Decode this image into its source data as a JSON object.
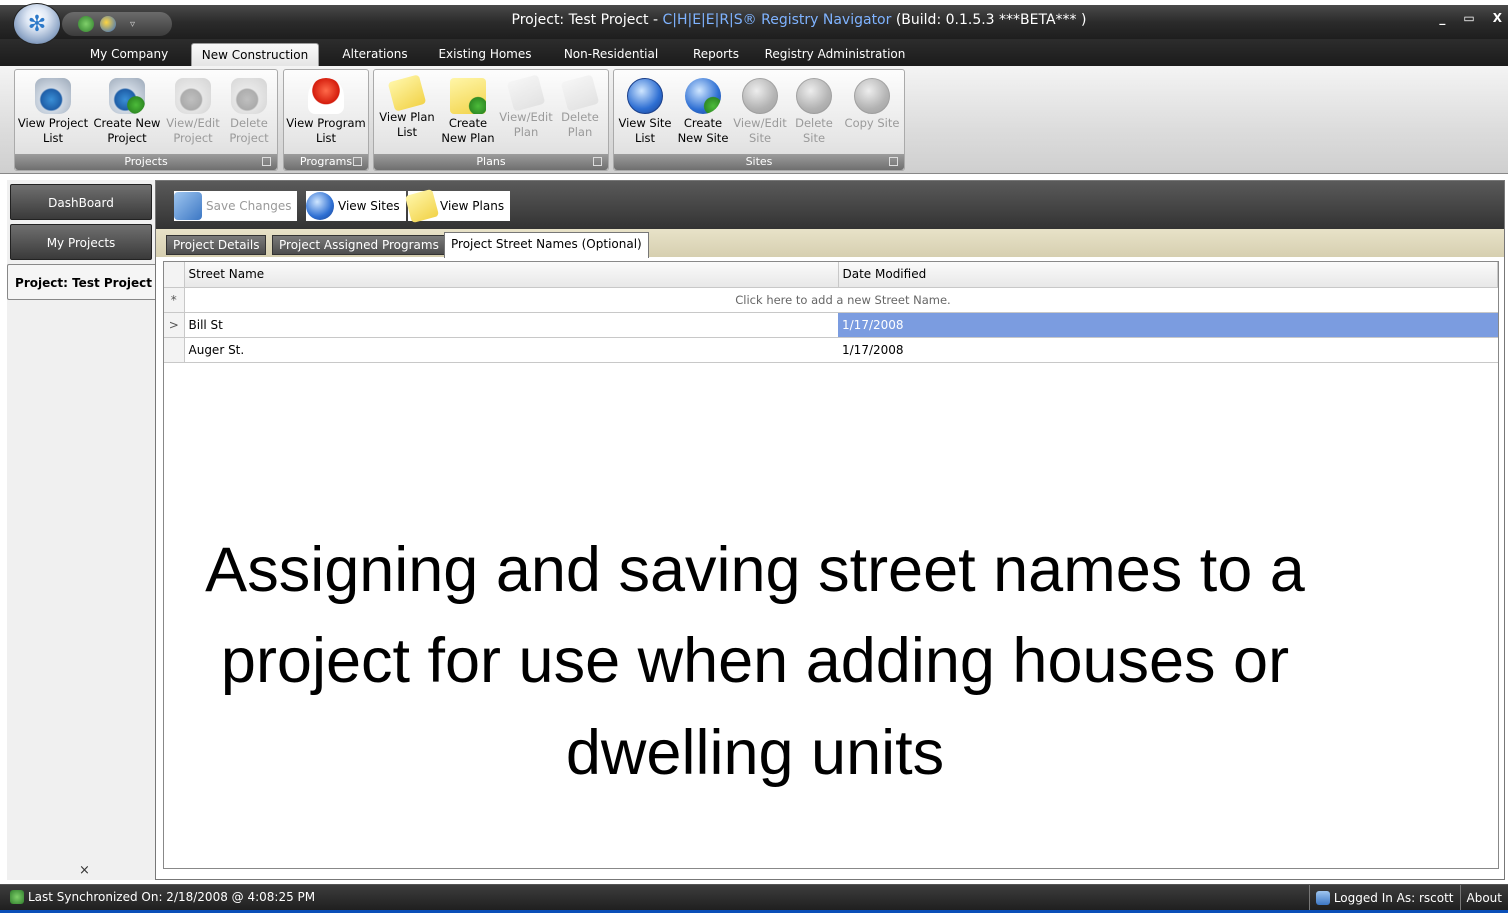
{
  "window": {
    "title_prefix": "Project: Test Project - ",
    "title_brand": "C|H|E|E|R|S® Registry Navigator",
    "title_suffix": " (Build: 0.1.5.3 ***BETA*** )",
    "controls": [
      "_",
      "▭",
      "X"
    ],
    "qat_more": "▿"
  },
  "ribbon_tabs": [
    {
      "label": "My Company"
    },
    {
      "label": "New Construction"
    },
    {
      "label": "Alterations"
    },
    {
      "label": "Existing Homes"
    },
    {
      "label": "Non-Residential"
    },
    {
      "label": "Reports"
    },
    {
      "label": "Registry Administration"
    }
  ],
  "ribbon_groups": {
    "projects": {
      "label": "Projects",
      "buttons": [
        {
          "line1": "View Project",
          "line2": "List",
          "icon": "jar-icon",
          "enabled": true
        },
        {
          "line1": "Create New",
          "line2": "Project",
          "icon": "jar-add-icon",
          "enabled": true
        },
        {
          "line1": "View/Edit",
          "line2": "Project",
          "icon": "jar-view-icon",
          "enabled": false
        },
        {
          "line1": "Delete",
          "line2": "Project",
          "icon": "jar-delete-icon",
          "enabled": false
        }
      ]
    },
    "programs": {
      "label": "Programs",
      "buttons": [
        {
          "line1": "View Program",
          "line2": "List",
          "icon": "award-ribbon-icon",
          "enabled": true
        }
      ]
    },
    "plans": {
      "label": "Plans",
      "buttons": [
        {
          "line1": "View Plan",
          "line2": "List",
          "icon": "note-icon",
          "enabled": true
        },
        {
          "line1": "Create",
          "line2": "New Plan",
          "icon": "note-add-icon",
          "enabled": true
        },
        {
          "line1": "View/Edit",
          "line2": "Plan",
          "icon": "note-view-icon",
          "enabled": false
        },
        {
          "line1": "Delete",
          "line2": "Plan",
          "icon": "note-delete-icon",
          "enabled": false
        }
      ]
    },
    "sites": {
      "label": "Sites",
      "buttons": [
        {
          "line1": "View Site",
          "line2": "List",
          "icon": "globe-icon",
          "enabled": true
        },
        {
          "line1": "Create",
          "line2": "New Site",
          "icon": "globe-add-icon",
          "enabled": true
        },
        {
          "line1": "View/Edit",
          "line2": "Site",
          "icon": "globe-view-icon",
          "enabled": false
        },
        {
          "line1": "Delete",
          "line2": "Site",
          "icon": "globe-delete-icon",
          "enabled": false
        },
        {
          "line1": "Copy Site",
          "line2": "",
          "icon": "globe-copy-icon",
          "enabled": false
        }
      ]
    }
  },
  "left_nav": {
    "items": [
      "DashBoard",
      "My Projects",
      "Project: Test Project"
    ],
    "close": "×"
  },
  "toolbar": {
    "save_label": "Save Changes",
    "view_sites_label": "View Sites",
    "view_plans_label": "View Plans"
  },
  "sub_tabs": [
    "Project Details",
    "Project Assigned Programs",
    "Project Street Names (Optional)"
  ],
  "grid": {
    "columns": [
      "Street Name",
      "Date Modified"
    ],
    "new_row_marker": "*",
    "new_row_text": "Click here to add a new Street Name.",
    "current_row_marker": ">",
    "rows": [
      {
        "street": "Bill St",
        "date": "1/17/2008"
      },
      {
        "street": "Auger St.",
        "date": "1/17/2008"
      }
    ]
  },
  "caption": {
    "line1": "Assigning and saving street names to a",
    "line2": "project for use when adding houses or",
    "line3": "dwelling units"
  },
  "status": {
    "sync": "Last Synchronized On: 2/18/2008 @ 4:08:25 PM",
    "logged_in": "Logged In As: rscott",
    "about": "About"
  }
}
